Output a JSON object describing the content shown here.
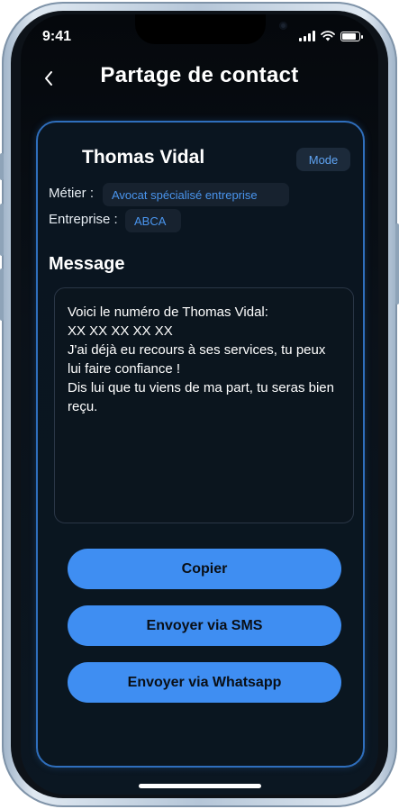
{
  "status_bar": {
    "time": "9:41",
    "battery_level": 0.85
  },
  "header": {
    "title": "Partage de contact"
  },
  "contact": {
    "name": "Thomas Vidal",
    "mode_label": "Mode",
    "job_label": "Métier :",
    "job_value": "Avocat spécialisé entreprise",
    "company_label": "Entreprise :",
    "company_value": "ABCA"
  },
  "message": {
    "title": "Message",
    "text": "Voici le numéro de Thomas Vidal:\nXX XX XX XX XX\nJ'ai déjà eu recours à ses services, tu peux lui faire confiance !\nDis lui que tu viens de ma part, tu seras bien reçu."
  },
  "actions": {
    "copy": "Copier",
    "sms": "Envoyer via SMS",
    "whatsapp": "Envoyer via Whatsapp"
  },
  "colors": {
    "accent": "#3f8ef2",
    "card_border": "#2f6fbd",
    "chip_text": "#4a95ee"
  }
}
